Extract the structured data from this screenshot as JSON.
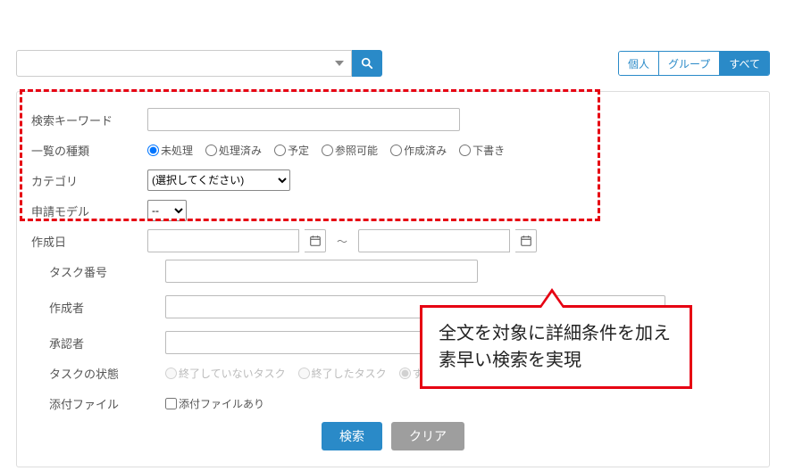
{
  "top": {
    "combo_value": "",
    "scope": {
      "personal": "個人",
      "group": "グループ",
      "all": "すべて",
      "active": "all"
    }
  },
  "form": {
    "keyword_label": "検索キーワード",
    "keyword_value": "",
    "listtype_label": "一覧の種類",
    "listtype_options": [
      "未処理",
      "処理済み",
      "予定",
      "参照可能",
      "作成済み",
      "下書き"
    ],
    "listtype_selected": "未処理",
    "category_label": "カテゴリ",
    "category_placeholder": "(選択してください)",
    "model_label": "申請モデル",
    "model_value": "--",
    "created_label": "作成日",
    "created_from": "",
    "created_to": "",
    "tasknum_label": "タスク番号",
    "tasknum_value": "",
    "creator_label": "作成者",
    "creator_value": "",
    "approver_label": "承認者",
    "approver_value": "",
    "state_label": "タスクの状態",
    "state_options": [
      "終了していないタスク",
      "終了したタスク",
      "すべて"
    ],
    "attach_label": "添付ファイル",
    "attach_cb_label": "添付ファイルあり",
    "attach_cb": false,
    "search_btn": "検索",
    "clear_btn": "クリア"
  },
  "callout": {
    "line1": "全文を対象に詳細条件を加え",
    "line2": "素早い検索を実現"
  },
  "colors": {
    "accent": "#2a8ac8",
    "redline": "#e60012"
  }
}
